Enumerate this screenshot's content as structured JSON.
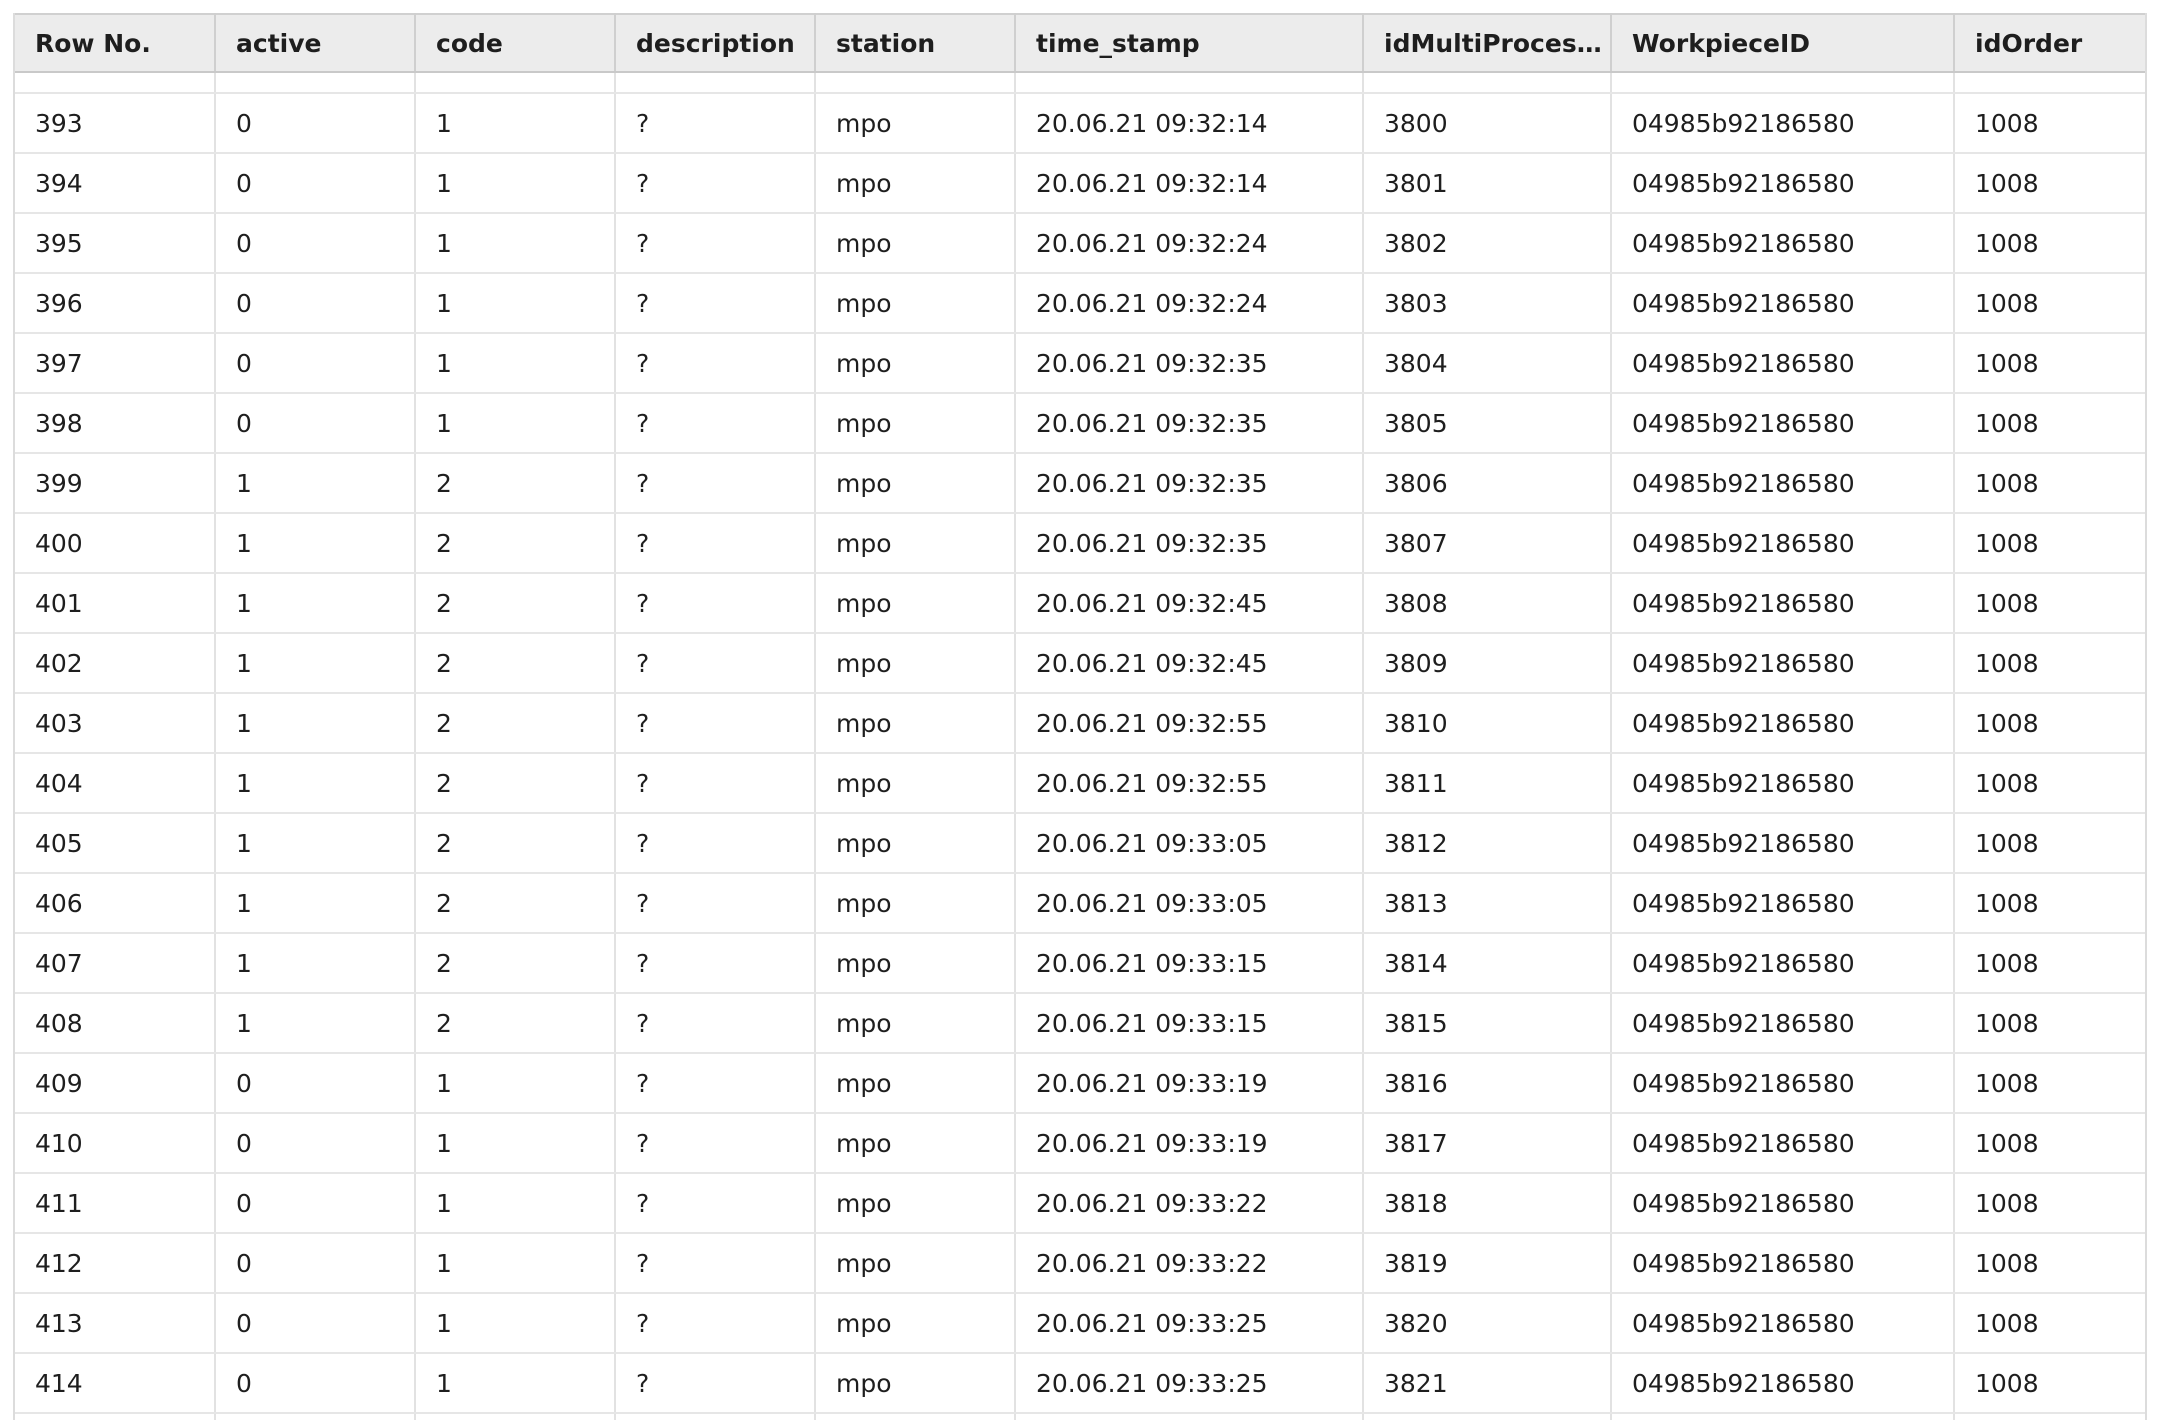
{
  "columns": [
    "Row No.",
    "active",
    "code",
    "description",
    "station",
    "time_stamp",
    "idMultiProcessi…",
    "WorkpieceID",
    "idOrder"
  ],
  "rows": [
    [
      "393",
      "0",
      "1",
      "?",
      "mpo",
      "20.06.21 09:32:14",
      "3800",
      "04985b92186580",
      "1008"
    ],
    [
      "394",
      "0",
      "1",
      "?",
      "mpo",
      "20.06.21 09:32:14",
      "3801",
      "04985b92186580",
      "1008"
    ],
    [
      "395",
      "0",
      "1",
      "?",
      "mpo",
      "20.06.21 09:32:24",
      "3802",
      "04985b92186580",
      "1008"
    ],
    [
      "396",
      "0",
      "1",
      "?",
      "mpo",
      "20.06.21 09:32:24",
      "3803",
      "04985b92186580",
      "1008"
    ],
    [
      "397",
      "0",
      "1",
      "?",
      "mpo",
      "20.06.21 09:32:35",
      "3804",
      "04985b92186580",
      "1008"
    ],
    [
      "398",
      "0",
      "1",
      "?",
      "mpo",
      "20.06.21 09:32:35",
      "3805",
      "04985b92186580",
      "1008"
    ],
    [
      "399",
      "1",
      "2",
      "?",
      "mpo",
      "20.06.21 09:32:35",
      "3806",
      "04985b92186580",
      "1008"
    ],
    [
      "400",
      "1",
      "2",
      "?",
      "mpo",
      "20.06.21 09:32:35",
      "3807",
      "04985b92186580",
      "1008"
    ],
    [
      "401",
      "1",
      "2",
      "?",
      "mpo",
      "20.06.21 09:32:45",
      "3808",
      "04985b92186580",
      "1008"
    ],
    [
      "402",
      "1",
      "2",
      "?",
      "mpo",
      "20.06.21 09:32:45",
      "3809",
      "04985b92186580",
      "1008"
    ],
    [
      "403",
      "1",
      "2",
      "?",
      "mpo",
      "20.06.21 09:32:55",
      "3810",
      "04985b92186580",
      "1008"
    ],
    [
      "404",
      "1",
      "2",
      "?",
      "mpo",
      "20.06.21 09:32:55",
      "3811",
      "04985b92186580",
      "1008"
    ],
    [
      "405",
      "1",
      "2",
      "?",
      "mpo",
      "20.06.21 09:33:05",
      "3812",
      "04985b92186580",
      "1008"
    ],
    [
      "406",
      "1",
      "2",
      "?",
      "mpo",
      "20.06.21 09:33:05",
      "3813",
      "04985b92186580",
      "1008"
    ],
    [
      "407",
      "1",
      "2",
      "?",
      "mpo",
      "20.06.21 09:33:15",
      "3814",
      "04985b92186580",
      "1008"
    ],
    [
      "408",
      "1",
      "2",
      "?",
      "mpo",
      "20.06.21 09:33:15",
      "3815",
      "04985b92186580",
      "1008"
    ],
    [
      "409",
      "0",
      "1",
      "?",
      "mpo",
      "20.06.21 09:33:19",
      "3816",
      "04985b92186580",
      "1008"
    ],
    [
      "410",
      "0",
      "1",
      "?",
      "mpo",
      "20.06.21 09:33:19",
      "3817",
      "04985b92186580",
      "1008"
    ],
    [
      "411",
      "0",
      "1",
      "?",
      "mpo",
      "20.06.21 09:33:22",
      "3818",
      "04985b92186580",
      "1008"
    ],
    [
      "412",
      "0",
      "1",
      "?",
      "mpo",
      "20.06.21 09:33:22",
      "3819",
      "04985b92186580",
      "1008"
    ],
    [
      "413",
      "0",
      "1",
      "?",
      "mpo",
      "20.06.21 09:33:25",
      "3820",
      "04985b92186580",
      "1008"
    ],
    [
      "414",
      "0",
      "1",
      "?",
      "mpo",
      "20.06.21 09:33:25",
      "3821",
      "04985b92186580",
      "1008"
    ]
  ]
}
